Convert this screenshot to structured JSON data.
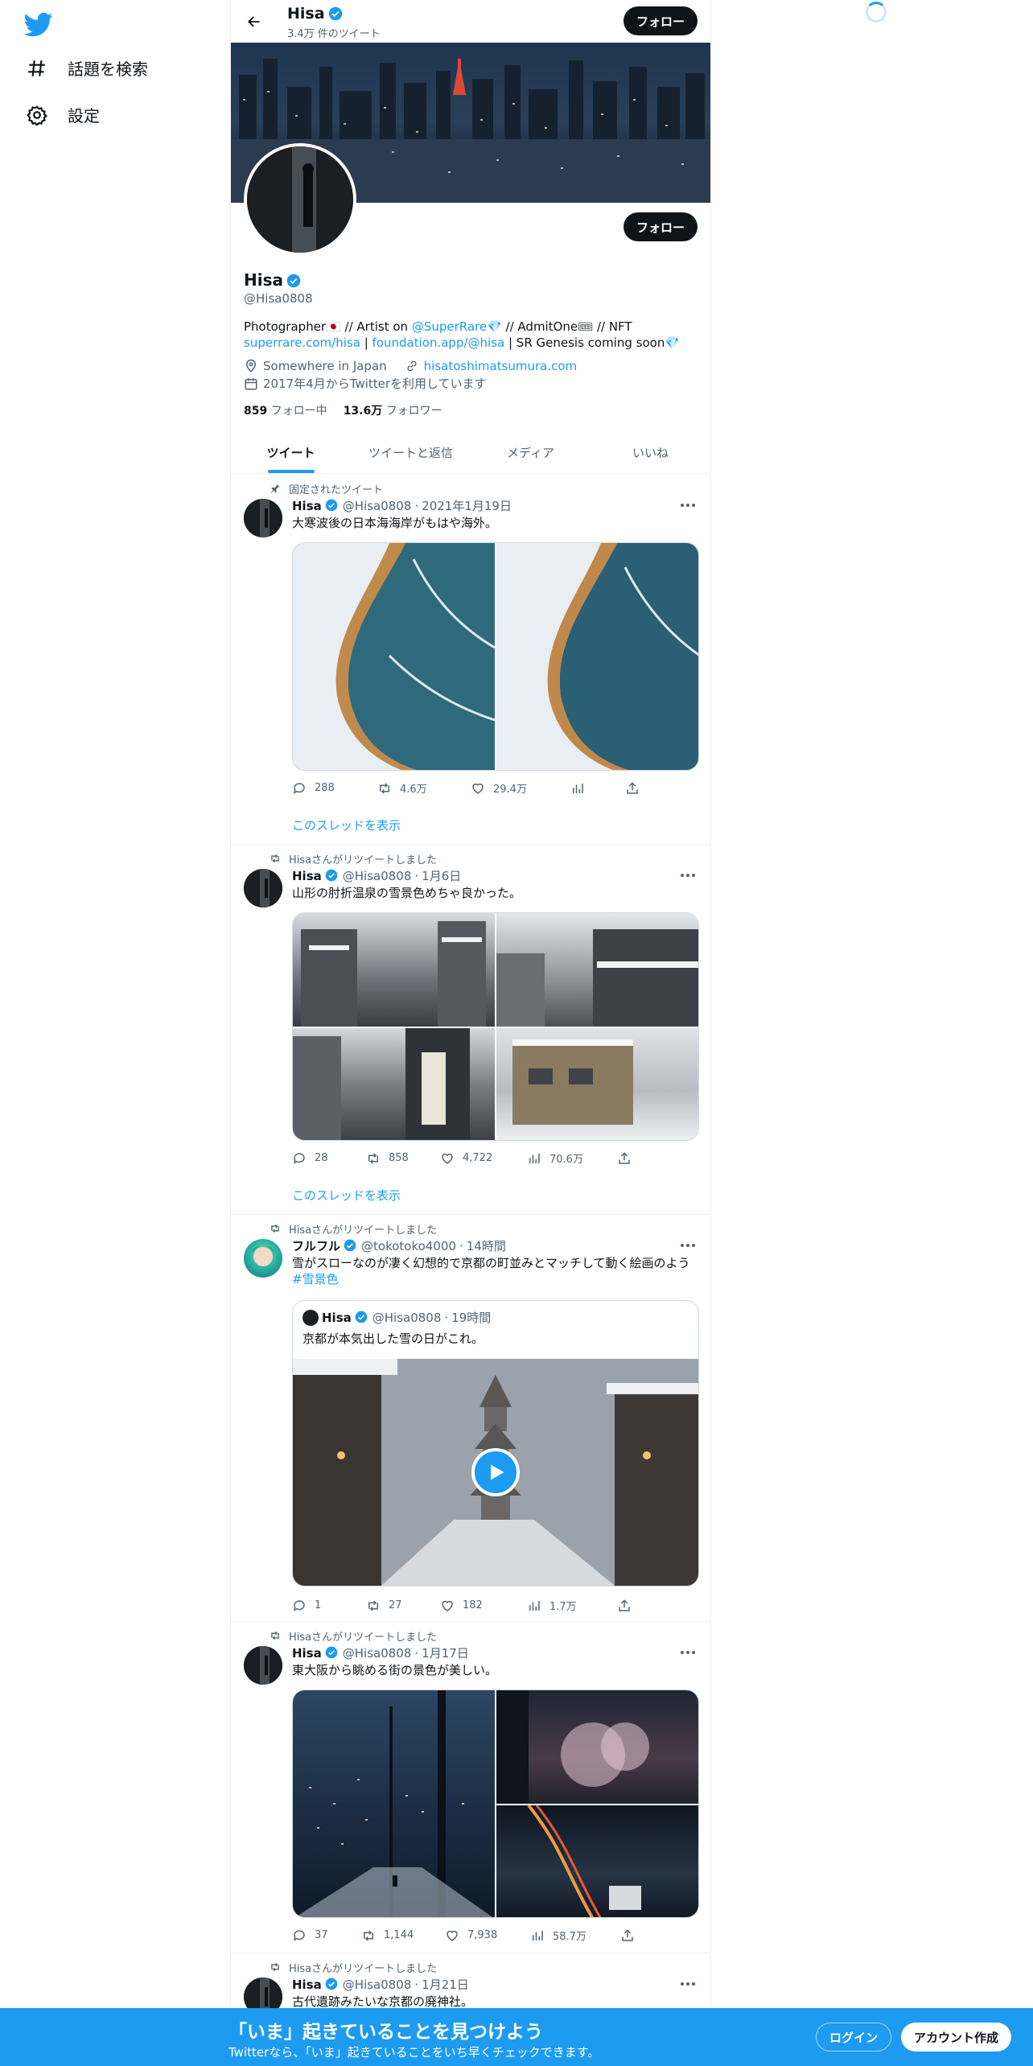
{
  "sidebar": {
    "items": [
      {
        "label": "話題を検索",
        "icon": "hashtag-icon"
      },
      {
        "label": "設定",
        "icon": "gear-icon"
      }
    ]
  },
  "header": {
    "name": "Hisa",
    "tweet_count": "3.4万 件のツイート",
    "follow_label": "フォロー"
  },
  "profile": {
    "name": "Hisa",
    "handle": "@Hisa0808",
    "follow_label": "フォロー",
    "bio_line1_pre": "Photographer🇯🇵 // Artist on ",
    "bio_line1_link": "@SuperRare",
    "bio_line1_post": "💎 // AdmitOne🎟 // NFT",
    "bio_line2_link1": "superrare.com/hisa",
    "bio_line2_sep": " | ",
    "bio_line2_link2": "foundation.app/@hisa",
    "bio_line2_post": " | SR Genesis coming soon💎",
    "location": "Somewhere in Japan",
    "website": "hisatoshimatsumura.com",
    "joined": "2017年4月からTwitterを利用しています",
    "following_count": "859",
    "following_label": "フォロー中",
    "followers_count": "13.6万",
    "followers_label": "フォロワー"
  },
  "tabs": [
    "ツイート",
    "ツイートと返信",
    "メディア",
    "いいね"
  ],
  "tweets": [
    {
      "context": "固定されたツイート",
      "name": "Hisa",
      "handle": "@Hisa0808",
      "date": "2021年1月19日",
      "text": "大寒波後の日本海海岸がもはや海外。",
      "replies": "288",
      "retweets": "4.6万",
      "likes": "29.4万",
      "views": "",
      "thread": "このスレッドを表示"
    },
    {
      "context": "Hisaさんがリツイートしました",
      "name": "Hisa",
      "handle": "@Hisa0808",
      "date": "1月6日",
      "text": "山形の肘折温泉の雪景色めちゃ良かった。",
      "replies": "28",
      "retweets": "858",
      "likes": "4,722",
      "views": "70.6万",
      "thread": "このスレッドを表示"
    },
    {
      "context": "Hisaさんがリツイートしました",
      "name": "フルフル",
      "handle": "@tokotoko4000",
      "date": "14時間",
      "text": "雪がスローなのが凄く幻想的で京都の町並みとマッチして動く絵画のよう",
      "hashtag": "#雪景色",
      "quote": {
        "name": "Hisa",
        "handle": "@Hisa0808",
        "date": "19時間",
        "text": "京都が本気出した雪の日がこれ。"
      },
      "replies": "1",
      "retweets": "27",
      "likes": "182",
      "views": "1.7万"
    },
    {
      "context": "Hisaさんがリツイートしました",
      "name": "Hisa",
      "handle": "@Hisa0808",
      "date": "1月17日",
      "text": "東大阪から眺める街の景色が美しい。",
      "replies": "37",
      "retweets": "1,144",
      "likes": "7,938",
      "views": "58.7万"
    },
    {
      "context": "Hisaさんがリツイートしました",
      "name": "Hisa",
      "handle": "@Hisa0808",
      "date": "1月21日",
      "text": "古代遺跡みたいな京都の廃神社。"
    }
  ],
  "bottom_bar": {
    "title": "「いま」起きていることを見つけよう",
    "subtitle": "Twitterなら、「いま」起きていることをいち早くチェックできます。",
    "login": "ログイン",
    "signup": "アカウント作成"
  },
  "colors": {
    "accent": "#1d9bf0",
    "text": "#0f1419",
    "secondary": "#536471",
    "border": "#eff3f4"
  }
}
